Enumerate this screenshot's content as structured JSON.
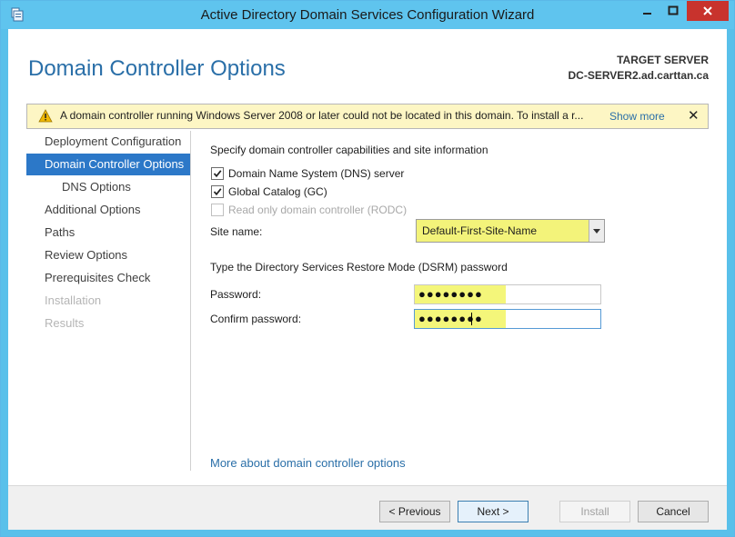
{
  "window": {
    "title": "Active Directory Domain Services Configuration Wizard"
  },
  "header": {
    "page_title": "Domain Controller Options",
    "target_label": "TARGET SERVER",
    "target_server": "DC-SERVER2.ad.carttan.ca"
  },
  "warning": {
    "text": "A domain controller running Windows Server 2008 or later could not be located in this domain. To install a r...",
    "link": "Show more",
    "close": "✕"
  },
  "nav": {
    "items": [
      {
        "label": "Deployment Configuration",
        "state": "normal"
      },
      {
        "label": "Domain Controller Options",
        "state": "active"
      },
      {
        "label": "DNS Options",
        "state": "sub"
      },
      {
        "label": "Additional Options",
        "state": "normal"
      },
      {
        "label": "Paths",
        "state": "normal"
      },
      {
        "label": "Review Options",
        "state": "normal"
      },
      {
        "label": "Prerequisites Check",
        "state": "normal"
      },
      {
        "label": "Installation",
        "state": "disabled"
      },
      {
        "label": "Results",
        "state": "disabled"
      }
    ]
  },
  "content": {
    "capabilities_heading": "Specify domain controller capabilities and site information",
    "dns_label": "Domain Name System (DNS) server",
    "dns_checked": true,
    "gc_label": "Global Catalog (GC)",
    "gc_checked": true,
    "rodc_label": "Read only domain controller (RODC)",
    "rodc_checked": false,
    "site_label": "Site name:",
    "site_value": "Default-First-Site-Name",
    "dsrm_heading": "Type the Directory Services Restore Mode (DSRM) password",
    "password_label": "Password:",
    "password_value": "●●●●●●●●",
    "confirm_label": "Confirm password:",
    "confirm_value": "●●●●●●●●",
    "more_link": "More about domain controller options"
  },
  "footer": {
    "previous": "< Previous",
    "next": "Next >",
    "install": "Install",
    "cancel": "Cancel"
  },
  "colors": {
    "accent": "#2c78c8",
    "titlebar": "#5fc4ee",
    "close_button": "#c8332d",
    "highlight": "#f3f37a",
    "warning_bg": "#fdf6c4"
  }
}
